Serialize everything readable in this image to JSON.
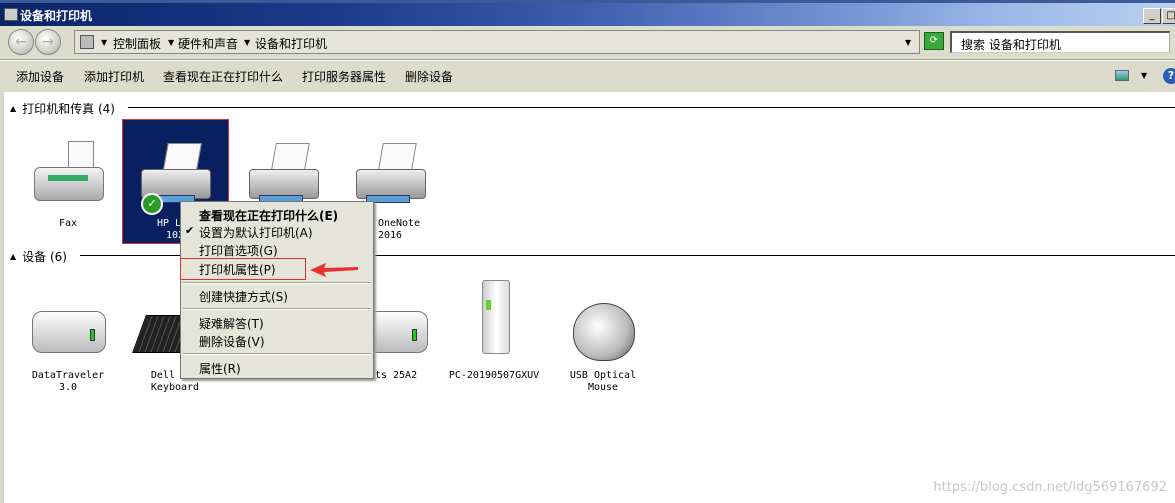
{
  "window": {
    "title": "设备和打印机"
  },
  "address": {
    "crumbs": [
      "控制面板",
      "硬件和声音",
      "设备和打印机"
    ],
    "search_placeholder": "搜索 设备和打印机"
  },
  "toolbar": {
    "items": [
      "添加设备",
      "添加打印机",
      "查看现在正在打印什么",
      "打印服务器属性",
      "删除设备"
    ]
  },
  "groups": {
    "printers": {
      "label": "打印机和传真 (4)",
      "items": [
        {
          "line1": "Fax",
          "line2": "",
          "icon": "fax-icon"
        },
        {
          "line1": "HP Las",
          "line2": "102",
          "icon": "printer-icon",
          "default": true,
          "selected": true
        },
        {
          "line1": "",
          "line2": "",
          "icon": "printer-icon"
        },
        {
          "line1": "To OneNote",
          "line2": "2016",
          "icon": "printer-icon"
        }
      ]
    },
    "devices": {
      "label": "设备 (6)",
      "items": [
        {
          "line1": "DataTraveler",
          "line2": "3.0",
          "icon": "drive-icon"
        },
        {
          "line1": "Dell USB",
          "line2": "Keyboard",
          "icon": "keyboard-icon"
        },
        {
          "line1": "ents 25A2",
          "line2": "",
          "icon": "drive-icon"
        },
        {
          "line1": "PC-20190507GXUV",
          "line2": "",
          "icon": "computer-icon"
        },
        {
          "line1": "USB Optical",
          "line2": "Mouse",
          "icon": "mouse-icon"
        }
      ]
    }
  },
  "context_menu": {
    "items": [
      "查看现在正在打印什么(E)",
      "设置为默认打印机(A)",
      "打印首选项(G)",
      "打印机属性(P)",
      "创建快捷方式(S)",
      "疑难解答(T)",
      "删除设备(V)",
      "属性(R)"
    ],
    "checked": "设置为默认打印机(A)",
    "highlighted": "打印机属性(P)",
    "checkmark": "✔"
  },
  "watermark": "https://blog.csdn.net/ldg569167692",
  "colors": {
    "selection": "#082060",
    "annotation": "#e03030"
  }
}
